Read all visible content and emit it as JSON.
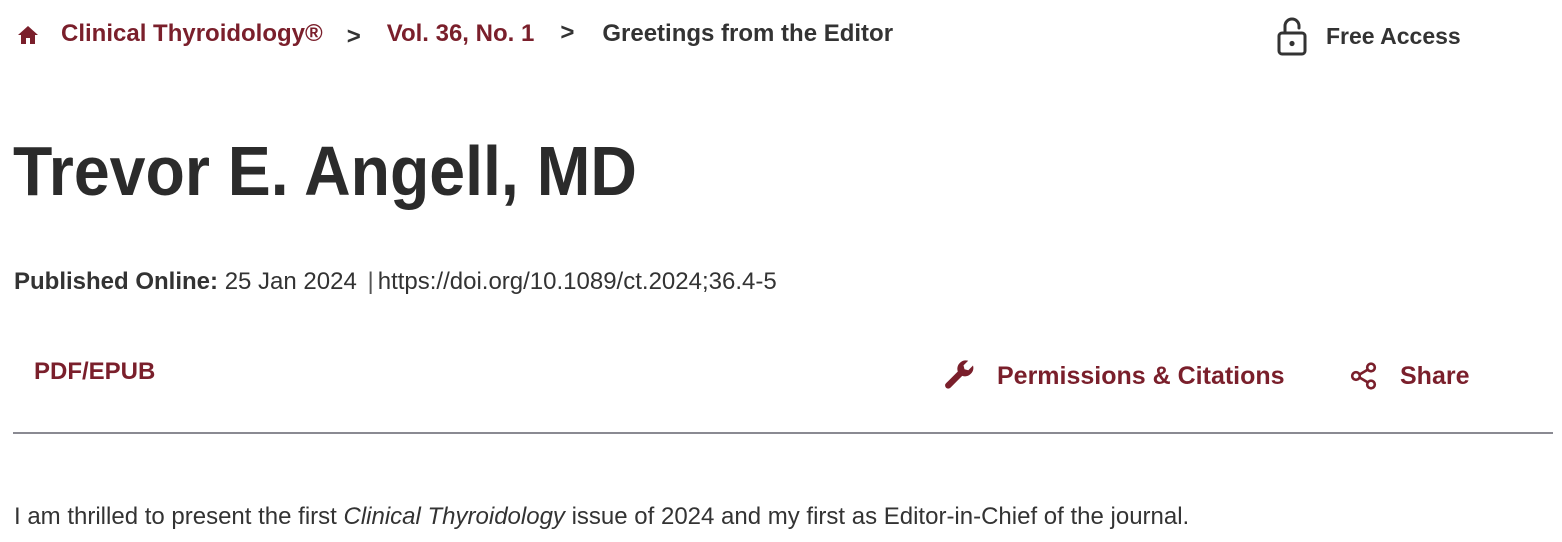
{
  "breadcrumb": {
    "home_icon": "home-icon",
    "items": [
      {
        "label": "Clinical Thyroidology®",
        "link": true
      },
      {
        "label": "Vol. 36, No. 1",
        "link": true
      },
      {
        "label": "Greetings from the Editor",
        "link": false
      }
    ],
    "separator": ">"
  },
  "access": {
    "icon": "unlock-icon",
    "label": "Free Access"
  },
  "article": {
    "title": "Trevor E. Angell, MD",
    "published_label": "Published Online:",
    "published_date": "25 Jan 2024",
    "meta_separator": "|",
    "doi": "https://doi.org/10.1089/ct.2024;36.4-5"
  },
  "toolbar": {
    "pdf_label": "PDF/EPUB",
    "permissions_label": "Permissions & Citations",
    "permissions_icon": "wrench-icon",
    "share_label": "Share",
    "share_icon": "share-icon"
  },
  "body": {
    "text_before": "I am thrilled to present the first ",
    "text_italic": "Clinical Thyroidology",
    "text_after": " issue of 2024 and my first as Editor-in-Chief of the journal."
  },
  "colors": {
    "accent": "#7a1f2b",
    "text": "#333333",
    "divider": "#8a8a92",
    "background": "#ffffff"
  }
}
